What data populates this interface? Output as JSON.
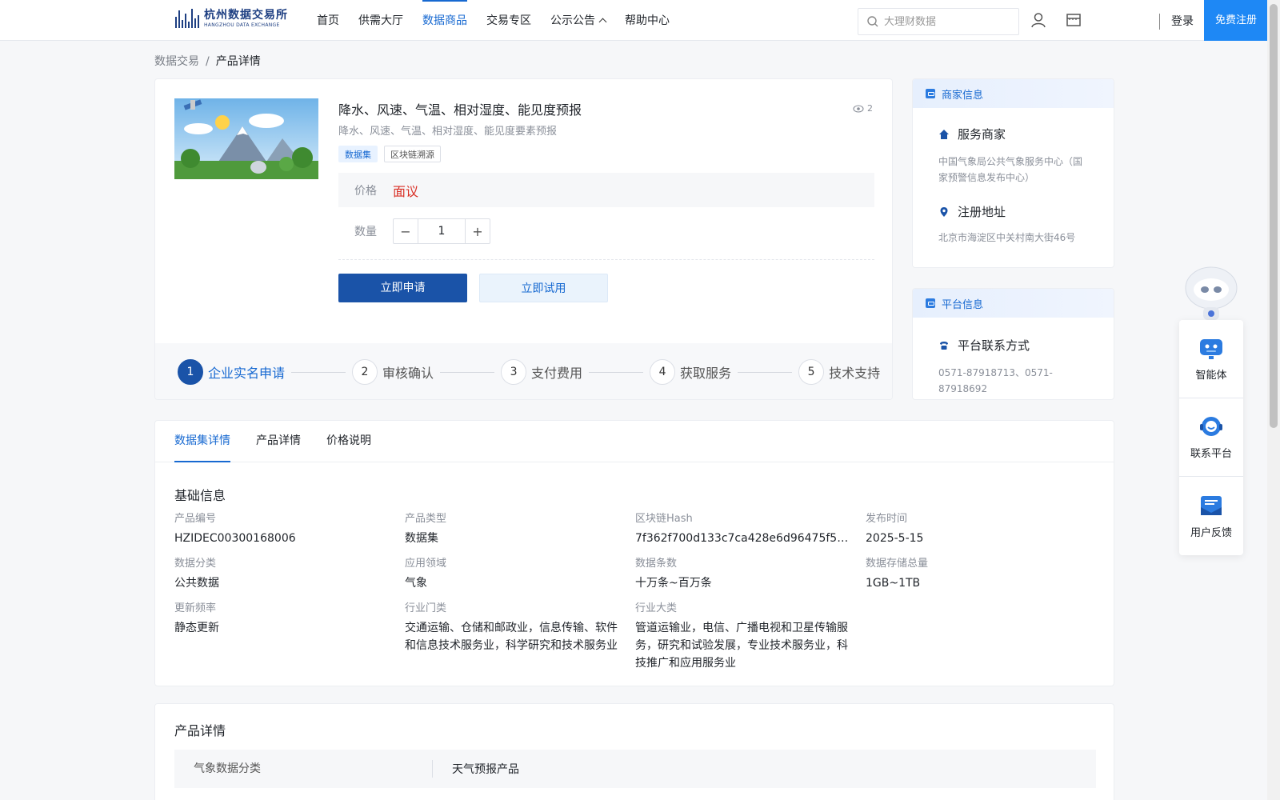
{
  "header": {
    "logo_cn": "杭州数据交易所",
    "logo_en": "HANGZHOU DATA EXCHANGE",
    "nav": [
      {
        "label": "首页"
      },
      {
        "label": "供需大厅"
      },
      {
        "label": "数据商品"
      },
      {
        "label": "交易专区"
      },
      {
        "label": "公示公告"
      },
      {
        "label": "帮助中心"
      }
    ],
    "search_placeholder": "大理财数据",
    "login": "登录",
    "register": "免费注册"
  },
  "breadcrumb": {
    "root": "数据交易",
    "sep": "/",
    "current": "产品详情"
  },
  "product": {
    "title": "降水、风速、气温、相对湿度、能见度预报",
    "subtitle": "降水、风速、气温、相对湿度、能见度要素预报",
    "views": "2",
    "tags": [
      "数据集",
      "区块链溯源"
    ],
    "price_label": "价格",
    "price_value": "面议",
    "qty_label": "数量",
    "qty_value": "1",
    "qty_minus": "−",
    "qty_plus": "+",
    "apply_btn": "立即申请",
    "trial_btn": "立即试用",
    "steps": [
      {
        "num": "1",
        "label": "企业实名申请"
      },
      {
        "num": "2",
        "label": "审核确认"
      },
      {
        "num": "3",
        "label": "支付费用"
      },
      {
        "num": "4",
        "label": "获取服务"
      },
      {
        "num": "5",
        "label": "技术支持"
      }
    ]
  },
  "merchant": {
    "head": "商家信息",
    "service_title": "服务商家",
    "service_value": "中国气象局公共气象服务中心（国家预警信息发布中心）",
    "addr_title": "注册地址",
    "addr_value": "北京市海淀区中关村南大街46号"
  },
  "platform": {
    "head": "平台信息",
    "contact_title": "平台联系方式",
    "contact_value": "0571-87918713、0571-87918692"
  },
  "float_menu": {
    "items": [
      {
        "label": "智能体"
      },
      {
        "label": "联系平台"
      },
      {
        "label": "用户反馈"
      }
    ]
  },
  "detail_tabs": [
    {
      "label": "数据集详情"
    },
    {
      "label": "产品详情"
    },
    {
      "label": "价格说明"
    }
  ],
  "basic_info": {
    "title": "基础信息",
    "fields": [
      {
        "k": "产品编号",
        "v": "HZIDEC00300168006"
      },
      {
        "k": "产品类型",
        "v": "数据集"
      },
      {
        "k": "区块链Hash",
        "v": "7f362f700d133c7ca428e6d96475f58e610..."
      },
      {
        "k": "发布时间",
        "v": "2025-5-15"
      },
      {
        "k": "数据分类",
        "v": "公共数据"
      },
      {
        "k": "应用领域",
        "v": "气象"
      },
      {
        "k": "数据条数",
        "v": "十万条~百万条"
      },
      {
        "k": "数据存储总量",
        "v": "1GB~1TB"
      },
      {
        "k": "更新频率",
        "v": "静态更新"
      },
      {
        "k": "行业门类",
        "v": "交通运输、仓储和邮政业，信息传输、软件和信息技术服务业，科学研究和技术服务业"
      },
      {
        "k": "行业大类",
        "v": "管道运输业，电信、广播电视和卫星传输服务，研究和试验发展，专业技术服务业，科技推广和应用服务业"
      }
    ]
  },
  "product_detail": {
    "title": "产品详情",
    "rows": [
      {
        "k": "气象数据分类",
        "v": "天气预报产品"
      }
    ]
  },
  "colors": {
    "accent": "#1769d1",
    "primary_btn": "#1a53a8",
    "price": "#d93026",
    "register": "#1e88f5"
  }
}
